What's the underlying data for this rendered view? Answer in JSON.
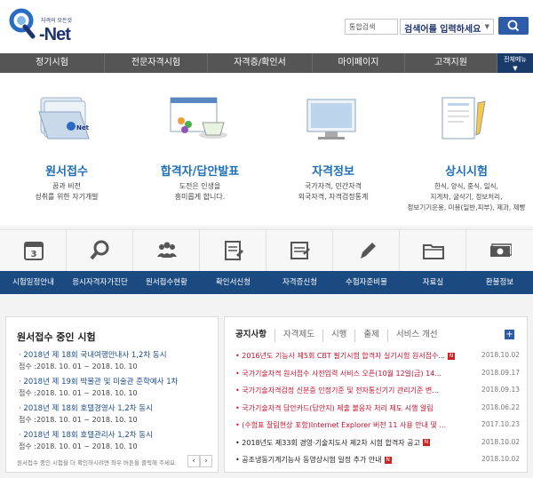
{
  "header": {
    "logo_small": "자격의 모든것",
    "logo_text": "Net",
    "search_select": "통합검색",
    "search_placeholder": "검색어를 입력하세요"
  },
  "nav": {
    "items": [
      "정기시험",
      "전문자격시험",
      "자격증/확인서",
      "마이페이지",
      "고객지원"
    ],
    "all_menu": "전체메뉴"
  },
  "features": [
    {
      "title": "원서접수",
      "desc1": "꿈과 비전",
      "desc2": "성취를 위한 자기개발",
      "desc3": "",
      "desc4": ""
    },
    {
      "title": "합격자/답안발표",
      "desc1": "도전은 인생을",
      "desc2": "흥미롭게 합니다.",
      "desc3": "",
      "desc4": ""
    },
    {
      "title": "자격정보",
      "desc1": "국가자격, 민간자격",
      "desc2": "외국자격, 자격검정통계",
      "desc3": "",
      "desc4": ""
    },
    {
      "title": "상시시험",
      "desc1": "한식, 양식, 중식, 일식,",
      "desc2": "지게차, 굴삭기, 정보처리,",
      "desc3": "정보기기운용, 미용(일반,피부), 제과, 제빵",
      "desc4": ""
    }
  ],
  "quick_menu": [
    {
      "label": "시험일정안내",
      "icon": "calendar-icon",
      "icon_text": "3"
    },
    {
      "label": "응시자격자가진단",
      "icon": "magnifier-icon"
    },
    {
      "label": "원서접수현황",
      "icon": "people-icon"
    },
    {
      "label": "확인서신청",
      "icon": "document-icon"
    },
    {
      "label": "자격증신청",
      "icon": "certificate-icon"
    },
    {
      "label": "수험자준비물",
      "icon": "pencil-icon"
    },
    {
      "label": "자료실",
      "icon": "folder-icon"
    },
    {
      "label": "환불정보",
      "icon": "money-icon"
    }
  ],
  "application": {
    "title": "원서접수 중인 시험",
    "items": [
      {
        "title": "2018년 제 18회 국내여행안내사 1,2차 동시",
        "date": "접수 :2018. 10. 01 ~ 2018. 10. 10"
      },
      {
        "title": "2018년 제 19회 박물관 및 미술관 준학예사 1차",
        "date": "접수 :2018. 10. 01 ~ 2018. 10. 10"
      },
      {
        "title": "2018년 제 18회 호텔경영사 1,2차 동시",
        "date": "접수 :2018. 10. 01 ~ 2018. 10. 10"
      },
      {
        "title": "2018년 제 18회 호텔관리사 1,2차 동시",
        "date": "접수 :2018. 10. 01 ~ 2018. 10. 10"
      }
    ],
    "footer": "원서접수 중인 시험을 더 확인하시려면 좌우 버튼을 클릭해 주세요.",
    "prev": "‹",
    "next": "›"
  },
  "notices": {
    "tabs": [
      "공지사항",
      "자격제도",
      "시행",
      "출제",
      "서비스 개선"
    ],
    "more": "+",
    "new_badge": "N",
    "items": [
      {
        "title": "2016년도 기능사 제5회 CBT 필기시험 합격자 실기시험 원서접수...",
        "date": "2018.10.02",
        "color": "#c8102e",
        "new": true
      },
      {
        "title": "국가기술자격 원서접수 사전입력 서비스 오픈(10월 12일(금) 14...",
        "date": "2018.09.17",
        "color": "#c8102e",
        "new": false
      },
      {
        "title": "국가기술자격검정 신분증 인정기준 및 전자통신기기 관리기준 변...",
        "date": "2018.09.13",
        "color": "#c8102e",
        "new": false
      },
      {
        "title": "국가기술자격 답안카드(답안지) 제출 불응자 처리 제도 시행 알림",
        "date": "2018.06.22",
        "color": "#c8102e",
        "new": false
      },
      {
        "title": "(수험표 잘림현상 포함)Internet Explorer 버전 11 사용 안내 및 ...",
        "date": "2017.10.23",
        "color": "#c8102e",
        "new": false
      },
      {
        "title": "2018년도 제33회 경영·기술지도사 제2차 시험 합격자 공고",
        "date": "2018.10.02",
        "color": "#222222",
        "new": true
      },
      {
        "title": "공조냉동기계기능사 동영상시험 일정 추가 안내",
        "date": "2018.10.02",
        "color": "#222222",
        "new": true
      }
    ]
  }
}
